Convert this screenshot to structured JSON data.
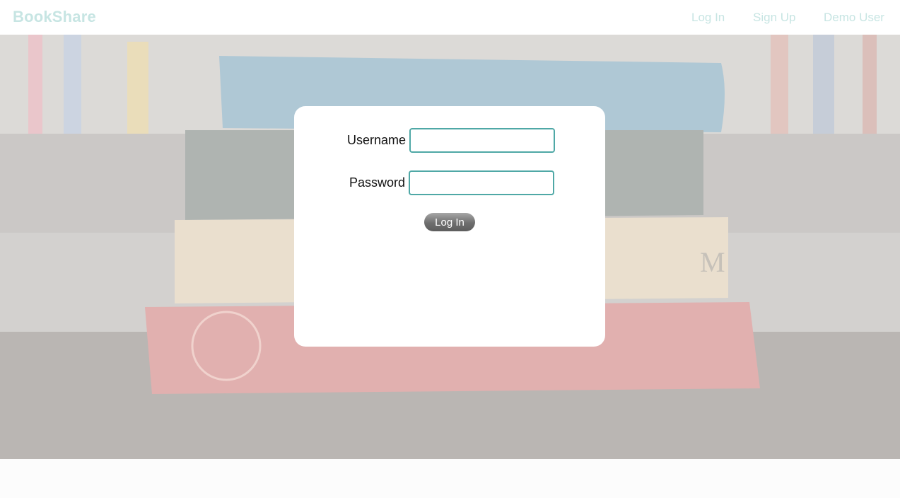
{
  "navbar": {
    "brand": "BookShare",
    "links": {
      "login": "Log In",
      "signup": "Sign Up",
      "demo": "Demo User"
    },
    "link_color": "#c7e5e3"
  },
  "login_form": {
    "username_label": "Username",
    "username_value": "",
    "password_label": "Password",
    "password_value": "",
    "submit_label": "Log In",
    "input_border_color": "#4fa8a6"
  },
  "hero": {
    "background_image": "stack-of-old-books"
  }
}
